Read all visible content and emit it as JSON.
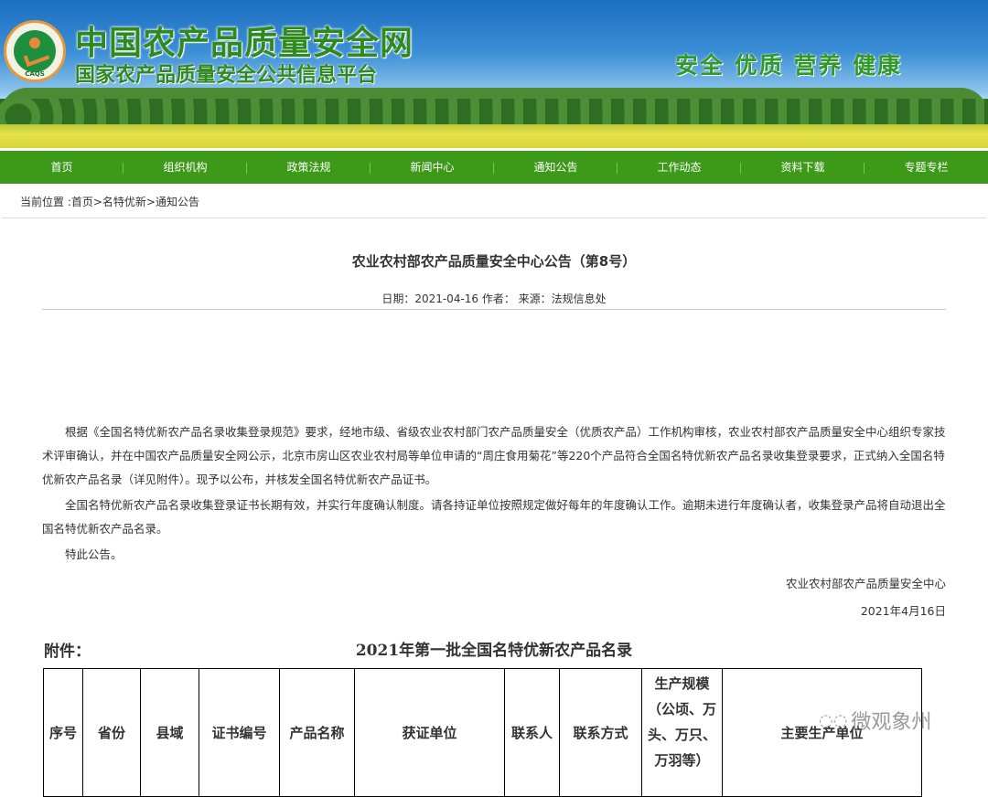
{
  "header": {
    "logo_text": "CAQS",
    "site_title": "中国农产品质量安全网",
    "subtitle": "国家农产品质量安全公共信息平台",
    "slogan": "安全 优质 营养 健康"
  },
  "nav": [
    "首页",
    "组织机构",
    "政策法规",
    "新闻中心",
    "通知公告",
    "工作动态",
    "资料下载",
    "专题专栏"
  ],
  "breadcrumb": "当前位置 :首页>名特优新>通知公告",
  "article": {
    "title": "农业农村部农产品质量安全中心公告（第8号）",
    "meta": "日期：2021-04-16 作者： 来源：法规信息处",
    "paragraphs": [
      "根据《全国名特优新农产品名录收集登录规范》要求，经地市级、省级农业农村部门农产品质量安全（优质农产品）工作机构审核，农业农村部农产品质量安全中心组织专家技术评审确认，并在中国农产品质量安全网公示，北京市房山区农业农村局等单位申请的“周庄食用菊花”等220个产品符合全国名特优新农产品名录收集登录要求，正式纳入全国名特优新农产品名录（详见附件）。现予以公布，并核发全国名特优新农产品证书。",
      "全国名特优新农产品名录收集登录证书长期有效，并实行年度确认制度。请各持证单位按照规定做好每年的年度确认工作。逾期未进行年度确认者，收集登录产品将自动退出全国名特优新农产品名录。",
      "特此公告。"
    ],
    "signature": "农业农村部农产品质量安全中心",
    "sign_date": "2021年4月16日"
  },
  "attachment": {
    "label": "附件：",
    "title": "2021年第一批全国名特优新农产品名录",
    "columns": [
      "序号",
      "省份",
      "县域",
      "证书编号",
      "产品名称",
      "获证单位",
      "联系人",
      "联系方式",
      "生产规模（公顷、万头、万只、万羽等）",
      "主要生产单位"
    ]
  },
  "watermark": "微观象州"
}
